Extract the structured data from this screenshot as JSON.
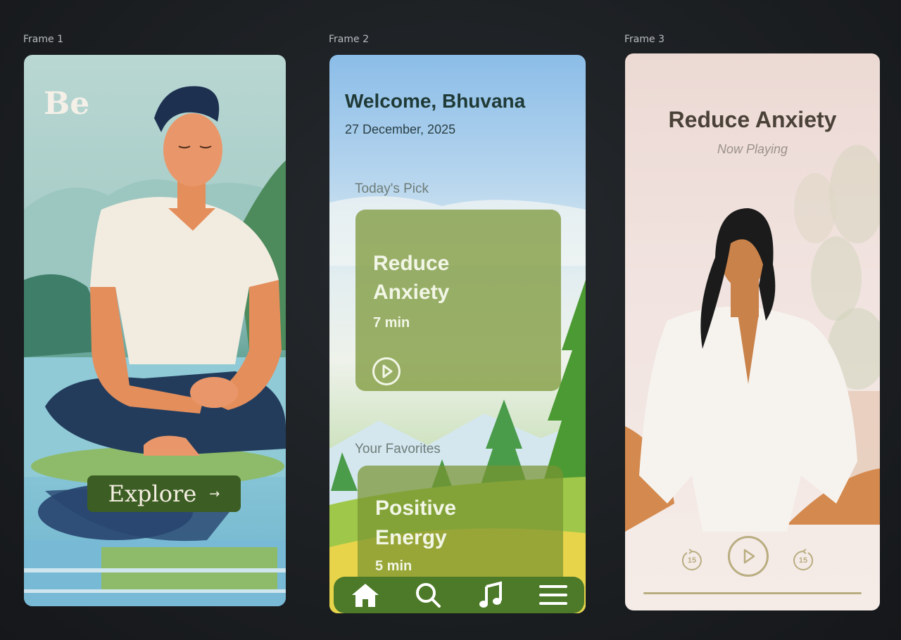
{
  "frames": [
    {
      "label": "Frame 1"
    },
    {
      "label": "Frame 2"
    },
    {
      "label": "Frame 3"
    }
  ],
  "frame1": {
    "logo": "Be",
    "explore_label": "Explore",
    "explore_arrow": "→"
  },
  "frame2": {
    "welcome": "Welcome, Bhuvana",
    "date": "27 December, 2025",
    "todays_pick_label": "Today's Pick",
    "todays_pick": {
      "title_line1": "Reduce",
      "title_line2": "Anxiety",
      "duration": "7 min"
    },
    "favorites_label": "Your Favorites",
    "favorite": {
      "title_line1": "Positive",
      "title_line2": "Energy",
      "duration": "5 min"
    },
    "nav": [
      {
        "icon": "home-icon"
      },
      {
        "icon": "search-icon"
      },
      {
        "icon": "music-icon"
      },
      {
        "icon": "menu-icon"
      }
    ],
    "accent": "#4c7a28"
  },
  "frame3": {
    "title": "Reduce Anxiety",
    "subtitle": "Now Playing",
    "rewind_seconds": "15",
    "forward_seconds": "15",
    "accent": "#b9ad80"
  }
}
